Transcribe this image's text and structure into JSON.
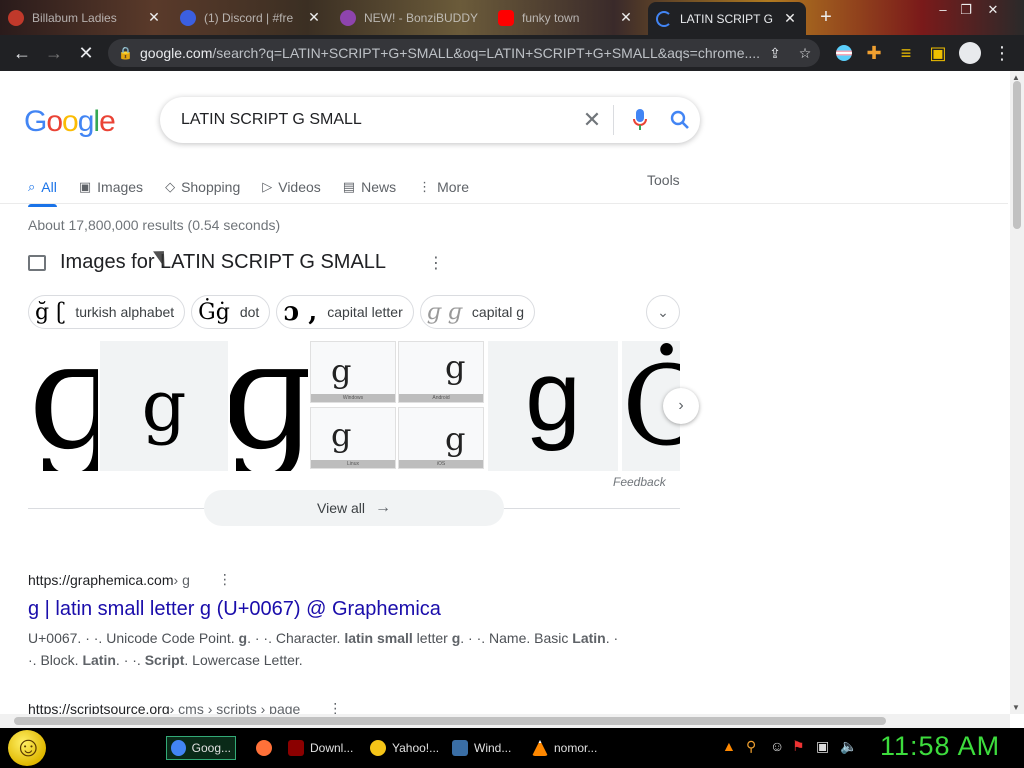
{
  "browser": {
    "tabs": [
      {
        "title": "Billabum Ladies",
        "color": "#c0392b"
      },
      {
        "title": "(1) Discord | #fre",
        "color": "#3b5fe0"
      },
      {
        "title": "NEW! - BonziBUDDY",
        "color": "#8e44ad"
      },
      {
        "title": "funky town",
        "color": "#ff0000"
      },
      {
        "title": "LATIN SCRIPT G SMALL",
        "color": "#4285f4"
      }
    ],
    "new_tab": "+",
    "window_controls": [
      "–",
      "❐",
      "✕"
    ],
    "url_host": "google.com",
    "url_rest": "/search?q=LATIN+SCRIPT+G+SMALL&oq=LATIN+SCRIPT+G+SMALL&aqs=chrome...."
  },
  "search": {
    "logo": [
      "G",
      "o",
      "o",
      "g",
      "l",
      "e"
    ],
    "logo_colors": [
      "#4285f4",
      "#ea4335",
      "#fbbc05",
      "#4285f4",
      "#34a853",
      "#ea4335"
    ],
    "query": "LATIN SCRIPT G SMALL",
    "tabs": [
      {
        "label": "All",
        "icon": "search-icon",
        "glyph": "🔍"
      },
      {
        "label": "Images",
        "icon": "image-icon",
        "glyph": "▣"
      },
      {
        "label": "Shopping",
        "icon": "tag-icon",
        "glyph": "◇"
      },
      {
        "label": "Videos",
        "icon": "play-icon",
        "glyph": "▷"
      },
      {
        "label": "News",
        "icon": "newspaper-icon",
        "glyph": "▤"
      },
      {
        "label": "More",
        "icon": "more-vert-icon",
        "glyph": "⋮"
      }
    ],
    "tools": "Tools",
    "stats": "About 17,800,000 results (0.54 seconds)"
  },
  "images": {
    "heading": "Images for LATIN SCRIPT G SMALL",
    "chips": [
      {
        "glyph": "ğ ʗ",
        "label": "turkish alphabet"
      },
      {
        "glyph": "Ġġ",
        "label": "dot"
      },
      {
        "glyph": "ɔ ,",
        "label": "capital letter"
      },
      {
        "glyph": "ɡ ɡ",
        "label": "capital g"
      }
    ],
    "thumb_glyphs": [
      "ɡ",
      "g",
      "ɡ",
      "g",
      "Ċ"
    ],
    "grid_labels": [
      "Windows",
      "Android",
      "Linux",
      "iOS"
    ],
    "feedback": "Feedback",
    "view_all": "View all"
  },
  "results": [
    {
      "site": "https://graphemica.com",
      "path": " › g",
      "title": "g | latin small letter g (U+0067) @ Graphemica",
      "snippet_html": "U+0067. · ·. Unicode Code Point. <b>g</b>. · ·. Character. <b>latin small</b> letter <b>g</b>. · ·. Name. Basic <b>Latin</b>. · ·. Block. <b>Latin</b>. · ·. <b>Script</b>. Lowercase Letter."
    },
    {
      "site": "https://scriptsource.org",
      "path": " › cms › scripts › page",
      "title": "",
      "snippet_html": ""
    }
  ],
  "taskbar": {
    "items": [
      {
        "label": "Goog...",
        "color": "#4285f4",
        "active": true
      },
      {
        "label": "",
        "color": "#ff7139",
        "active": false
      },
      {
        "label": "Downl...",
        "color": "#8b0000",
        "active": false
      },
      {
        "label": "Yahoo!...",
        "color": "#f5c518",
        "active": false
      },
      {
        "label": "Wind...",
        "color": "#3a6ea5",
        "active": false
      },
      {
        "label": "nomor...",
        "color": "#ff8800",
        "active": false
      }
    ],
    "clock": "11:58 AM"
  }
}
